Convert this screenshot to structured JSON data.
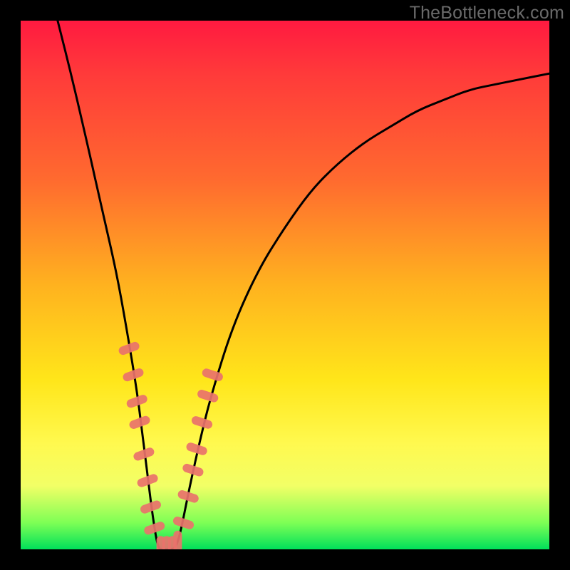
{
  "watermark": {
    "text": "TheBottleneck.com"
  },
  "chart_data": {
    "type": "line",
    "title": "",
    "xlabel": "",
    "ylabel": "",
    "xlim": [
      0,
      100
    ],
    "ylim": [
      0,
      100
    ],
    "grid": false,
    "legend": false,
    "series": [
      {
        "name": "bottleneck-curve",
        "comment": "V-shaped curve; y read as percent of plot height from bottom at each x percent",
        "x": [
          7,
          10,
          13,
          15,
          18,
          20,
          22,
          23,
          24,
          25,
          26,
          27,
          28,
          29,
          30,
          32,
          34,
          36,
          40,
          45,
          50,
          55,
          60,
          65,
          70,
          75,
          80,
          85,
          90,
          95,
          100
        ],
        "y": [
          100,
          88,
          75,
          66,
          53,
          42,
          30,
          22,
          14,
          6,
          0,
          0,
          0,
          0,
          2,
          12,
          21,
          29,
          42,
          53,
          61,
          68,
          73,
          77,
          80,
          83,
          85,
          87,
          88,
          89,
          90
        ]
      }
    ],
    "markers": {
      "name": "highlight-dots",
      "comment": "Salmon-pink elongated markers clustered near the valley on both branches",
      "points": [
        {
          "x": 20.5,
          "y": 38
        },
        {
          "x": 21.3,
          "y": 33
        },
        {
          "x": 22.0,
          "y": 28
        },
        {
          "x": 22.5,
          "y": 24
        },
        {
          "x": 23.3,
          "y": 18
        },
        {
          "x": 24.0,
          "y": 13
        },
        {
          "x": 24.6,
          "y": 8
        },
        {
          "x": 25.3,
          "y": 4
        },
        {
          "x": 26.5,
          "y": 0.5
        },
        {
          "x": 27.6,
          "y": 0.5
        },
        {
          "x": 28.7,
          "y": 0.5
        },
        {
          "x": 29.7,
          "y": 1.5
        },
        {
          "x": 30.8,
          "y": 5
        },
        {
          "x": 31.7,
          "y": 10
        },
        {
          "x": 32.6,
          "y": 15
        },
        {
          "x": 33.3,
          "y": 19
        },
        {
          "x": 34.3,
          "y": 24
        },
        {
          "x": 35.4,
          "y": 29
        },
        {
          "x": 36.3,
          "y": 33
        }
      ]
    },
    "colors": {
      "curve": "#000000",
      "marker": "#e9726b",
      "gradient_top": "#ff1a40",
      "gradient_bottom": "#00e05a"
    }
  }
}
